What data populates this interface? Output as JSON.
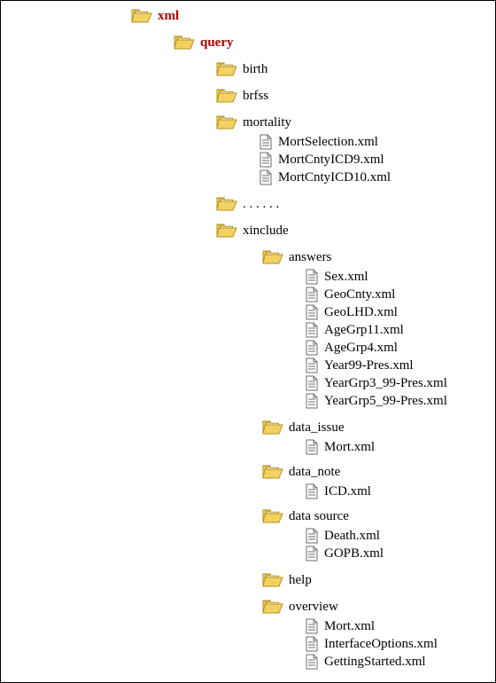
{
  "icons": {
    "folder_open_color": "#f3d163",
    "folder_outline": "#b4921d",
    "file_fill": "#ffffff",
    "file_outline": "#6b6b6b",
    "file_line": "#6b6b6b"
  },
  "tree": {
    "xml": {
      "label": "xml",
      "style": "bold-red"
    },
    "query": {
      "label": "query",
      "style": "bold-red"
    },
    "birth": {
      "label": "birth"
    },
    "brfss": {
      "label": "brfss"
    },
    "mortality": {
      "label": "mortality"
    },
    "mortality_files": [
      "MortSelection.xml",
      "MortCntyICD9.xml",
      "MortCntyICD10.xml"
    ],
    "ellipsis": {
      "label": ". . . . . ."
    },
    "xinclude": {
      "label": "xinclude"
    },
    "answers": {
      "label": "answers"
    },
    "answers_files": [
      "Sex.xml",
      "GeoCnty.xml",
      "GeoLHD.xml",
      "AgeGrp11.xml",
      "AgeGrp4.xml",
      "Year99-Pres.xml",
      "YearGrp3_99-Pres.xml",
      "YearGrp5_99-Pres.xml"
    ],
    "data_issue": {
      "label": "data_issue"
    },
    "data_issue_files": [
      "Mort.xml"
    ],
    "data_note": {
      "label": "data_note"
    },
    "data_note_files": [
      "ICD.xml"
    ],
    "data_source": {
      "label": "data source"
    },
    "data_source_files": [
      "Death.xml",
      "GOPB.xml"
    ],
    "help": {
      "label": "help"
    },
    "overview": {
      "label": "overview"
    },
    "overview_files": [
      "Mort.xml",
      "InterfaceOptions.xml",
      "GettingStarted.xml"
    ]
  }
}
